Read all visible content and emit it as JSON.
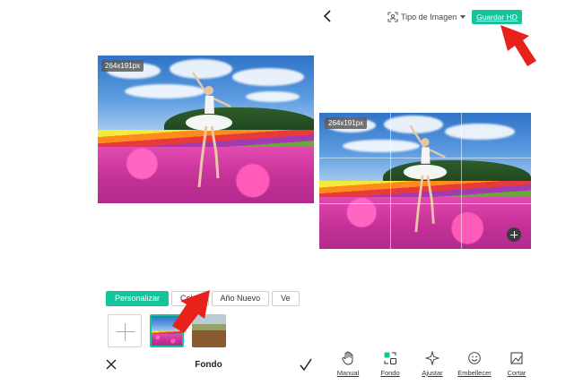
{
  "left": {
    "dimensions_badge": "264x191px",
    "tabs": [
      {
        "label": "Personalizar",
        "active": true
      },
      {
        "label": "Color",
        "active": false
      },
      {
        "label": "Año Nuevo",
        "active": false
      },
      {
        "label": "Ve",
        "active": false
      }
    ],
    "title": "Fondo"
  },
  "right": {
    "image_type_label": "Tipo de Imagen",
    "save_label": "Guardar HD",
    "dimensions_badge": "264x191px",
    "tools": [
      {
        "label": "Manual",
        "icon": "hand-icon"
      },
      {
        "label": "Fondo",
        "icon": "background-icon"
      },
      {
        "label": "Ajustar",
        "icon": "sparkle-icon"
      },
      {
        "label": "Embellecer",
        "icon": "smile-icon"
      },
      {
        "label": "Cortar",
        "icon": "crop-icon"
      }
    ]
  },
  "colors": {
    "accent": "#14c49a",
    "arrow": "#e8221b"
  }
}
